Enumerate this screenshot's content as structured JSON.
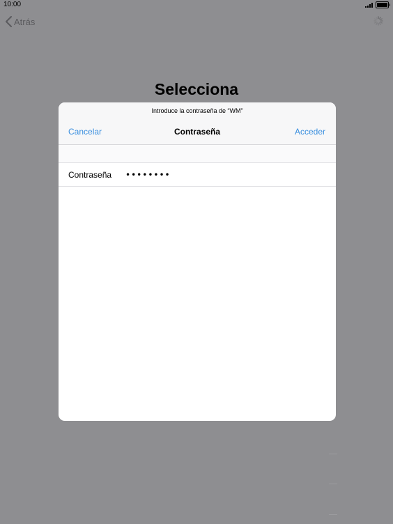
{
  "status_bar": {
    "time": "10:00",
    "signal_icon": "signal-bars-icon",
    "battery_icon": "battery-full-icon"
  },
  "nav": {
    "back_label": "Atrás",
    "back_icon": "chevron-left-icon",
    "loading_icon": "spinner-icon"
  },
  "page": {
    "title": "Selecciona"
  },
  "modal": {
    "prompt": "Introduce la contraseña de “WM”",
    "cancel_label": "Cancelar",
    "title": "Contraseña",
    "join_label": "Acceder",
    "password_label": "Contraseña",
    "password_value": "••••••••"
  },
  "colors": {
    "accent": "#3a8fdf",
    "background_dim": "#8e8e91",
    "modal_background": "#ffffff"
  }
}
